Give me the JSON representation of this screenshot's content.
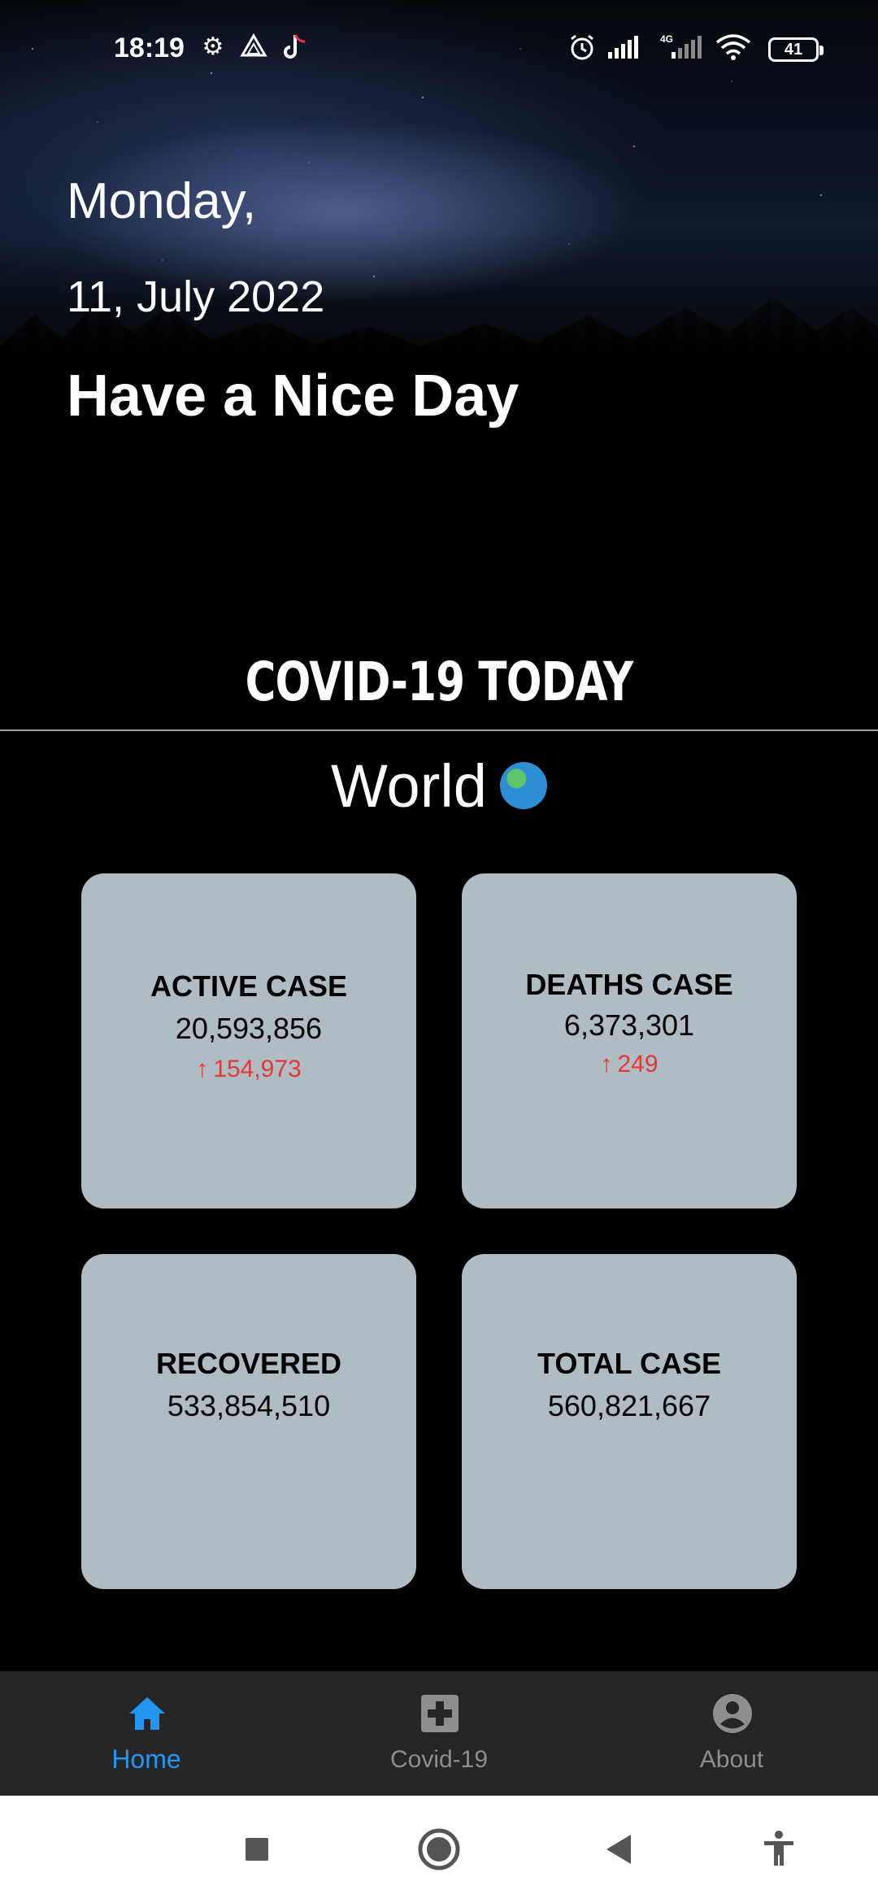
{
  "status_bar": {
    "time": "18:19",
    "battery": "41",
    "network": "4G"
  },
  "greeting": {
    "day": "Monday,",
    "date": "11, July 2022",
    "message": "Have a Nice Day"
  },
  "section": {
    "title": "COVID-19 TODAY",
    "region": "World"
  },
  "cards": {
    "active": {
      "title": "ACTIVE CASE",
      "value": "20,593,856",
      "delta": "154,973"
    },
    "deaths": {
      "title": "DEATHS CASE",
      "value": "6,373,301",
      "delta": "249"
    },
    "recovered": {
      "title": "RECOVERED",
      "value": "533,854,510"
    },
    "total": {
      "title": "TOTAL CASE",
      "value": "560,821,667"
    }
  },
  "nav": {
    "home": "Home",
    "covid": "Covid-19",
    "about": "About"
  },
  "colors": {
    "accent": "#2196f3",
    "card_bg": "#afbcc3",
    "delta": "#e53935",
    "nav_bg": "#262626"
  }
}
